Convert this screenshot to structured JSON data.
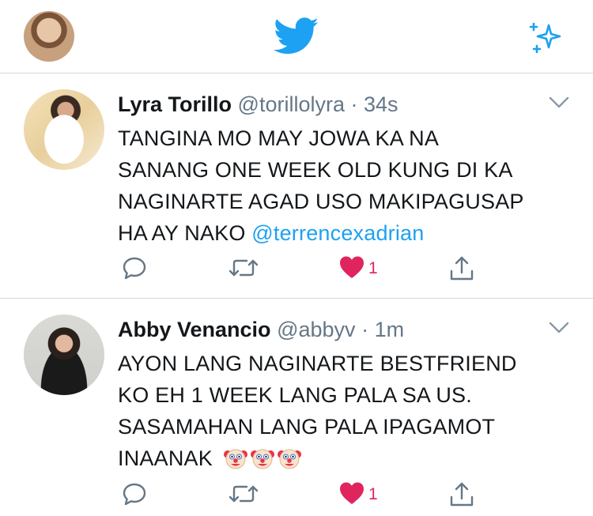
{
  "header": {
    "avatar_icon": "profile-avatar",
    "logo_icon": "twitter-bird-icon",
    "sparkle_icon": "sparkle-icon"
  },
  "tweets": [
    {
      "name": "Lyra Torillo",
      "handle": "@torillolyra",
      "separator": "·",
      "time": "34s",
      "lines": [
        "TANGINA MO MAY JOWA KA NA",
        "SANANG ONE WEEK OLD KUNG DI KA",
        "NAGINARTE AGAD USO MAKIPAGUSAP",
        "HA AY NAKO"
      ],
      "mention": "@terrencexadrian",
      "likes": "1"
    },
    {
      "name": "Abby Venancio",
      "handle": "@abbyv",
      "separator": "·",
      "time": "1m",
      "lines": [
        "AYON LANG NAGINARTE BESTFRIEND",
        "KO EH 1 WEEK LANG PALA SA US.",
        "SASAMAHAN LANG PALA IPAGAMOT",
        "INAANAK"
      ],
      "emojis": [
        "clown-face-emoji",
        "clown-face-emoji",
        "clown-face-emoji"
      ],
      "likes": "1"
    }
  ],
  "colors": {
    "accent": "#1da1f2",
    "like": "#e0245e",
    "muted": "#657786",
    "divider": "#d6dadd"
  }
}
